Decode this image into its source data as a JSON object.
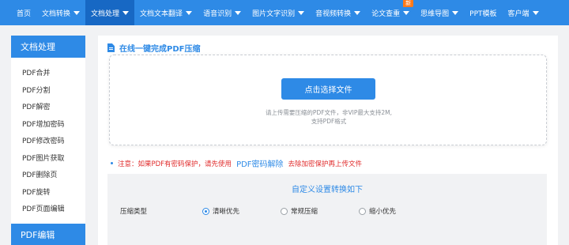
{
  "nav": {
    "items": [
      {
        "label": "首页",
        "dropdown": false
      },
      {
        "label": "文档转换",
        "dropdown": true
      },
      {
        "label": "文档处理",
        "dropdown": true,
        "active": true
      },
      {
        "label": "文档文本翻译",
        "dropdown": true
      },
      {
        "label": "语音识别",
        "dropdown": true
      },
      {
        "label": "图片文字识别",
        "dropdown": true
      },
      {
        "label": "音视频转换",
        "dropdown": true
      },
      {
        "label": "论文查重",
        "dropdown": true,
        "badge": "新"
      },
      {
        "label": "思维导图",
        "dropdown": true
      },
      {
        "label": "PPT模板",
        "dropdown": false
      },
      {
        "label": "客户端",
        "dropdown": true
      }
    ],
    "colors": {
      "bar": "#2e8ae6",
      "active": "#1768c4",
      "badge": "#ff7a1a"
    }
  },
  "sidebar": {
    "section_title": "文档处理",
    "items": [
      "PDF合并",
      "PDF分割",
      "PDF解密",
      "PDF增加密码",
      "PDF修改密码",
      "PDF图片获取",
      "PDF删除页",
      "PDF旋转",
      "PDF页面编辑"
    ],
    "next_section_title": "PDF编辑"
  },
  "main": {
    "title": "在线一键完成PDF压缩",
    "title_icon": "document-icon",
    "upload": {
      "button_label": "点击选择文件",
      "hint_line1": "请上传需要压缩的PDF文件，非VIP最大支持2M,",
      "hint_line2": "支持PDF格式"
    },
    "notice": {
      "prefix": "注意：如果PDF有密码保护，请先使用",
      "link": "PDF密码解除",
      "suffix": "去除加密保护再上传文件"
    },
    "settings": {
      "title": "自定义设置转换如下",
      "row_label": "压缩类型",
      "options": [
        {
          "label": "清晰优先",
          "checked": true
        },
        {
          "label": "常规压缩",
          "checked": false
        },
        {
          "label": "缩小优先",
          "checked": false
        }
      ]
    }
  }
}
